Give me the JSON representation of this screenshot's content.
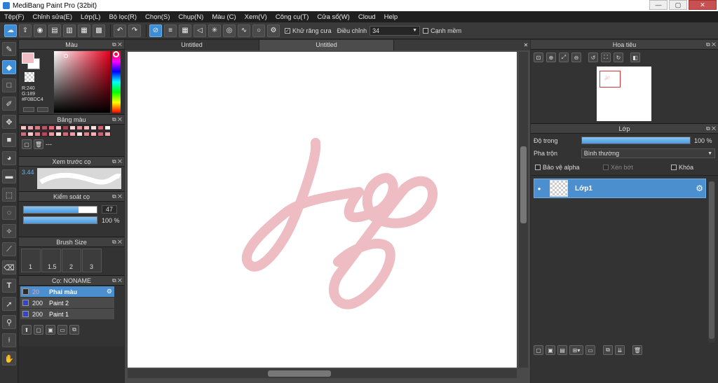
{
  "title": "MediBang Paint Pro (32bit)",
  "menu": [
    "Tệp(F)",
    "Chỉnh sửa(E)",
    "Lớp(L)",
    "Bộ lọc(R)",
    "Chọn(S)",
    "Chụp(N)",
    "Màu (C)",
    "Xem(V)",
    "Công cụ(T)",
    "Cửa sổ(W)",
    "Cloud",
    "Help"
  ],
  "toolbar": {
    "antialias_label": "Khử răng cưa",
    "adjust_label": "Điều chỉnh",
    "adjust_value": "34",
    "smooth_edge_label": "Cạnh mềm"
  },
  "panels": {
    "color": {
      "title": "Màu",
      "r": "R:240",
      "g": "G:189",
      "hex": "#F0BDC4",
      "fg": "#F0BDC4",
      "bg": "#ffffff"
    },
    "palette": {
      "title": "Bảng màu",
      "dash": "---",
      "row1": [
        "#f2c4c8",
        "#e8a3aa",
        "#d47b86",
        "#b85665",
        "#e86a7a",
        "#f0bdc4",
        "#a34556",
        "#f7d4d8",
        "#e3909b",
        "#f3b7be",
        "#fbe1e4",
        "#d15f70",
        "#ffffff"
      ],
      "row2": [
        "#c9707e",
        "#f5c9ce",
        "#d8808c",
        "#b44a5c",
        "#e69aa4",
        "#fbdde1",
        "#cf6b7a",
        "#ee9ea9",
        "#fae3e6",
        "#dc8591",
        "#f4b3bb",
        "#c86275",
        "#e9a5ae"
      ]
    },
    "brush_preview": {
      "title": "Xem trước cọ",
      "size": "3.44"
    },
    "brush_control": {
      "title": "Kiểm soát cọ",
      "size_value": "47",
      "size_fraction": 0.75,
      "opacity_value": "100 %",
      "opacity_fraction": 1.0
    },
    "brush_size": {
      "title": "Brush Size",
      "sizes": [
        "1",
        "1.5",
        "2",
        "3"
      ]
    },
    "brush_list": {
      "title": "Cọ: NONAME",
      "items": [
        {
          "size": "20",
          "name": "Phai màu",
          "color": "#2b2b2b",
          "selected": true
        },
        {
          "size": "200",
          "name": "Paint 2",
          "color": "#3344cc",
          "selected": false
        },
        {
          "size": "200",
          "name": "Paint 1",
          "color": "#3344cc",
          "selected": false
        }
      ]
    },
    "navigator": {
      "title": "Hoa tiêu"
    },
    "layer": {
      "title": "Lớp",
      "opacity_label": "Độ trong",
      "opacity_value": "100 %",
      "blend_label": "Pha trộn",
      "blend_value": "Bình thường",
      "protect_alpha": "Bảo vệ alpha",
      "clipping": "Xén bớt",
      "lock": "Khóa",
      "layers": [
        {
          "name": "Lớp1"
        }
      ]
    }
  },
  "tabs": [
    "Untitled",
    "Untitled"
  ],
  "canvas": {
    "stroke_color": "#eebcc3"
  }
}
